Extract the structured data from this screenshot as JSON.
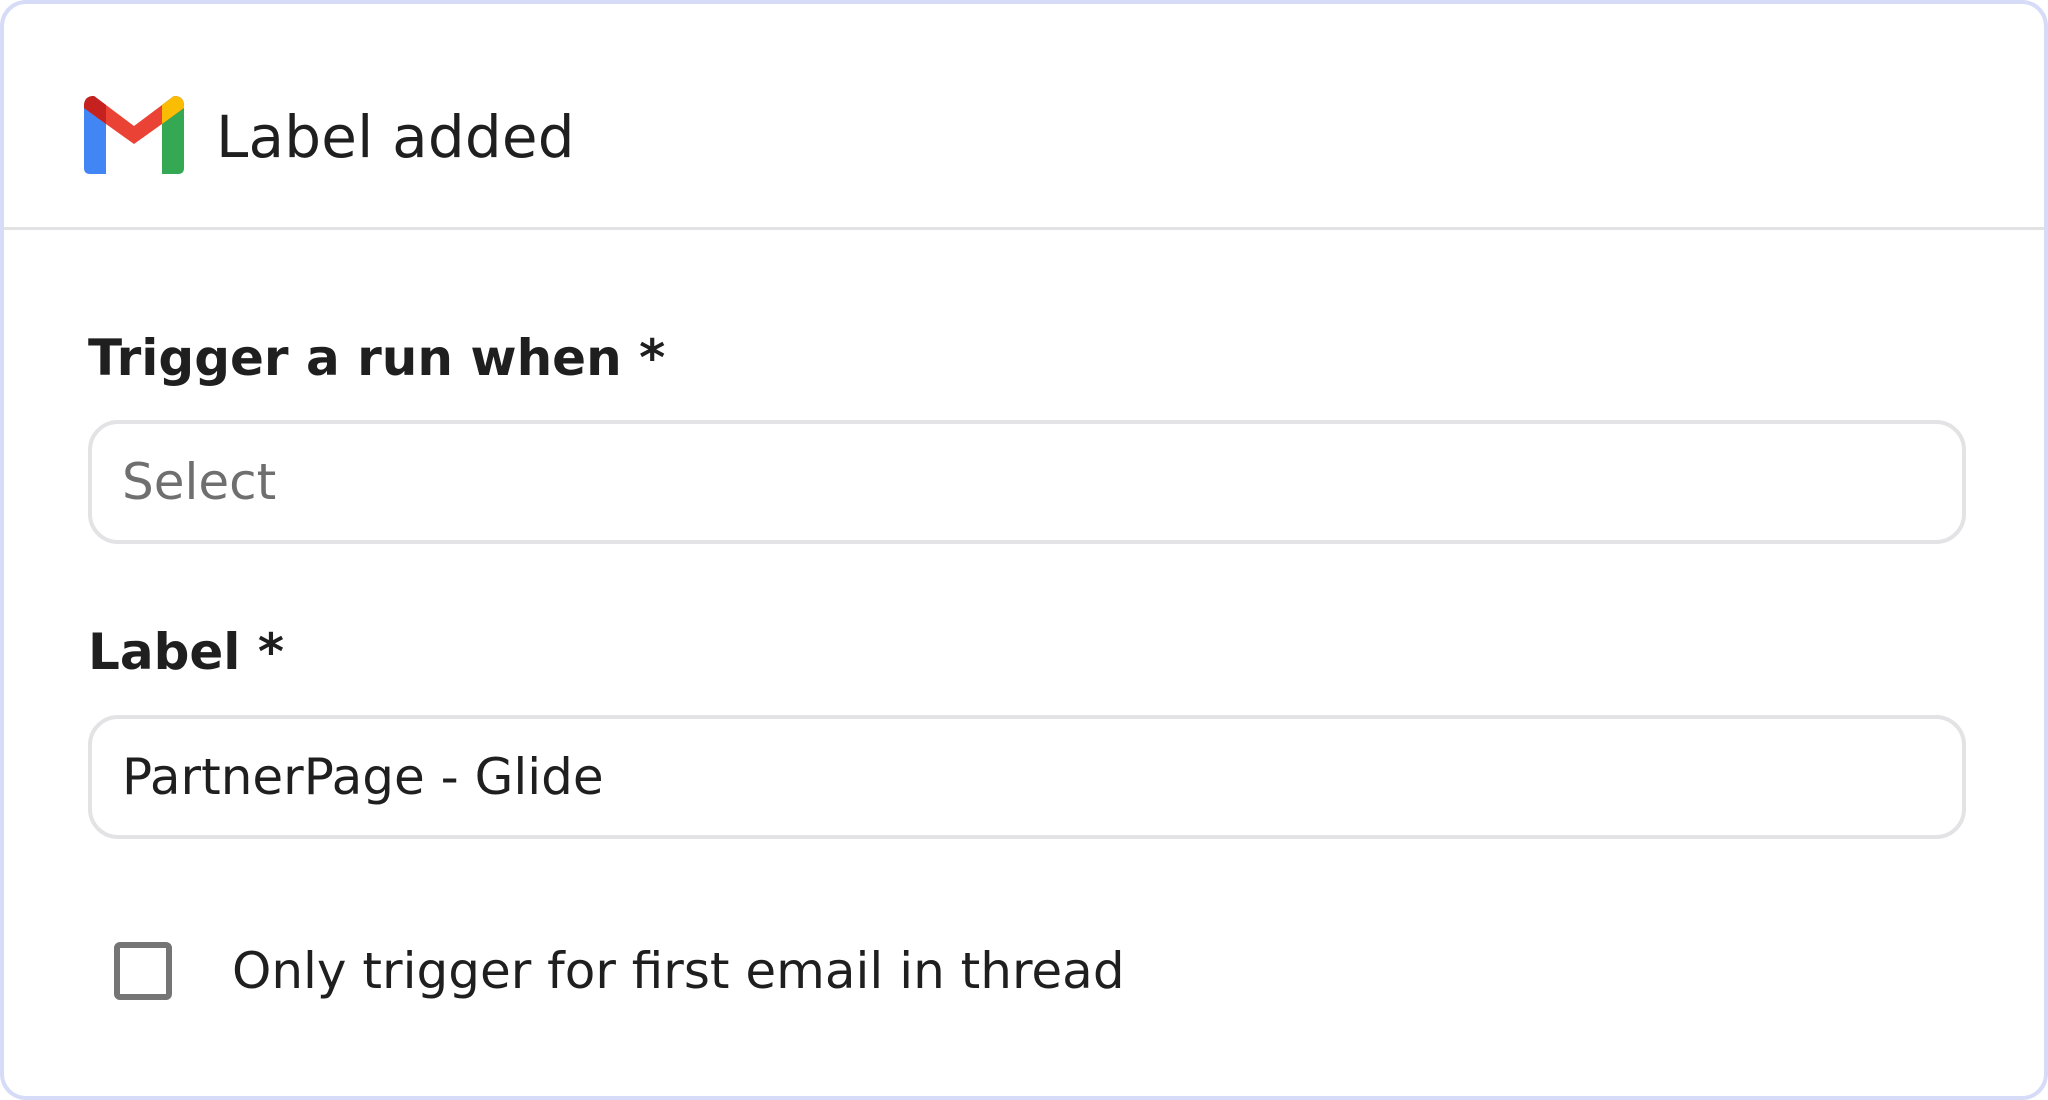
{
  "header": {
    "icon": "gmail-icon",
    "title": "Label added"
  },
  "form": {
    "trigger": {
      "label": "Trigger a run when *",
      "placeholder": "Select",
      "value": ""
    },
    "label_field": {
      "label": "Label *",
      "value": "PartnerPage - Glide"
    },
    "first_email_only": {
      "label": "Only trigger for first email in thread",
      "checked": false
    }
  },
  "colors": {
    "card_border": "#d6dcf7",
    "divider": "#e3e3e6",
    "text": "#1f1f1f",
    "placeholder": "#6f6f6f",
    "gmail_red": "#ea4335",
    "gmail_blue": "#4285f4",
    "gmail_green": "#34a853",
    "gmail_yellow": "#fbbc04"
  }
}
